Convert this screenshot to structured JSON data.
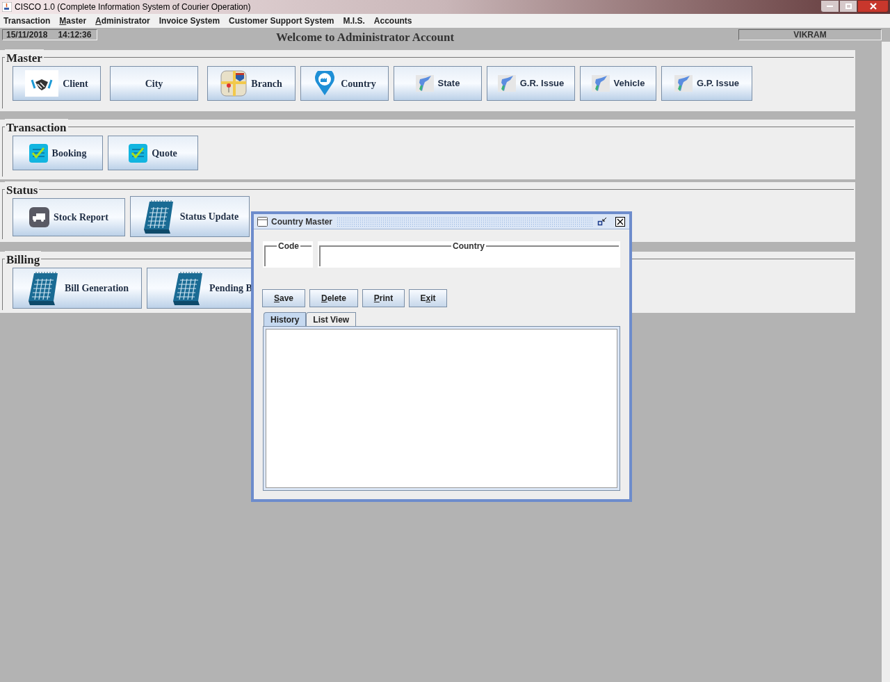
{
  "window": {
    "title": "CISCO 1.0 (Complete Information System of Courier Operation)"
  },
  "menu": [
    {
      "label": "Transaction"
    },
    {
      "label": "Master"
    },
    {
      "label": "Administrator"
    },
    {
      "label": "Invoice System"
    },
    {
      "label": "Customer Support System"
    },
    {
      "label": "M.I.S."
    },
    {
      "label": "Accounts"
    }
  ],
  "status_row": {
    "date": "15/11/2018",
    "time": "14:12:36",
    "welcome": "Welcome to Administrator Account",
    "user": "VIKRAM"
  },
  "sections": [
    {
      "title": "Master",
      "buttons": [
        {
          "label": "Client"
        },
        {
          "label": "City"
        },
        {
          "label": "Branch"
        },
        {
          "label": "Country"
        },
        {
          "label": "State"
        },
        {
          "label": "G.R. Issue"
        },
        {
          "label": "Vehicle"
        },
        {
          "label": "G.P. Issue"
        }
      ]
    },
    {
      "title": "Transaction",
      "buttons": [
        {
          "label": "Booking"
        },
        {
          "label": "Quote"
        }
      ]
    },
    {
      "title": "Status",
      "buttons": [
        {
          "label": "Stock Report"
        },
        {
          "label": "Status Update"
        }
      ]
    },
    {
      "title": "Billing",
      "buttons": [
        {
          "label": "Bill Generation"
        },
        {
          "label": "Pending B"
        }
      ]
    }
  ],
  "dialog": {
    "title": "Country Master",
    "fields": [
      {
        "label": "Code"
      },
      {
        "label": "Country"
      }
    ],
    "buttons": [
      {
        "label": "Save"
      },
      {
        "label": "Delete"
      },
      {
        "label": "Print"
      },
      {
        "label": "Exit"
      }
    ],
    "tabs": [
      {
        "label": "History",
        "selected": true
      },
      {
        "label": "List View",
        "selected": false
      }
    ]
  }
}
